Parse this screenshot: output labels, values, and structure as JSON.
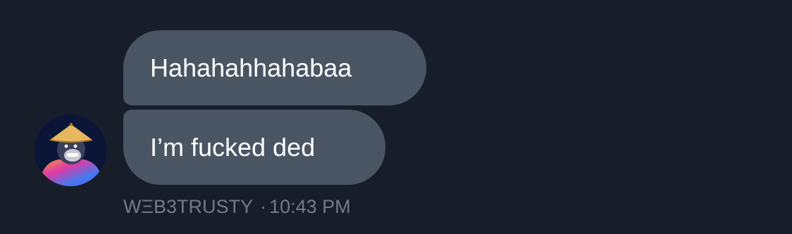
{
  "messages": [
    {
      "text": "Hahahahhahabaa"
    },
    {
      "text": "I’m fucked ded"
    }
  ],
  "sender": {
    "name": "WΞB3TRUSTY",
    "separator": "·",
    "time": "10:43 PM",
    "avatar_icon": "gorilla-avatar-icon"
  },
  "colors": {
    "background": "#171d29",
    "bubble": "#4a5564",
    "meta_text": "#727c89",
    "message_text": "#ffffff"
  }
}
